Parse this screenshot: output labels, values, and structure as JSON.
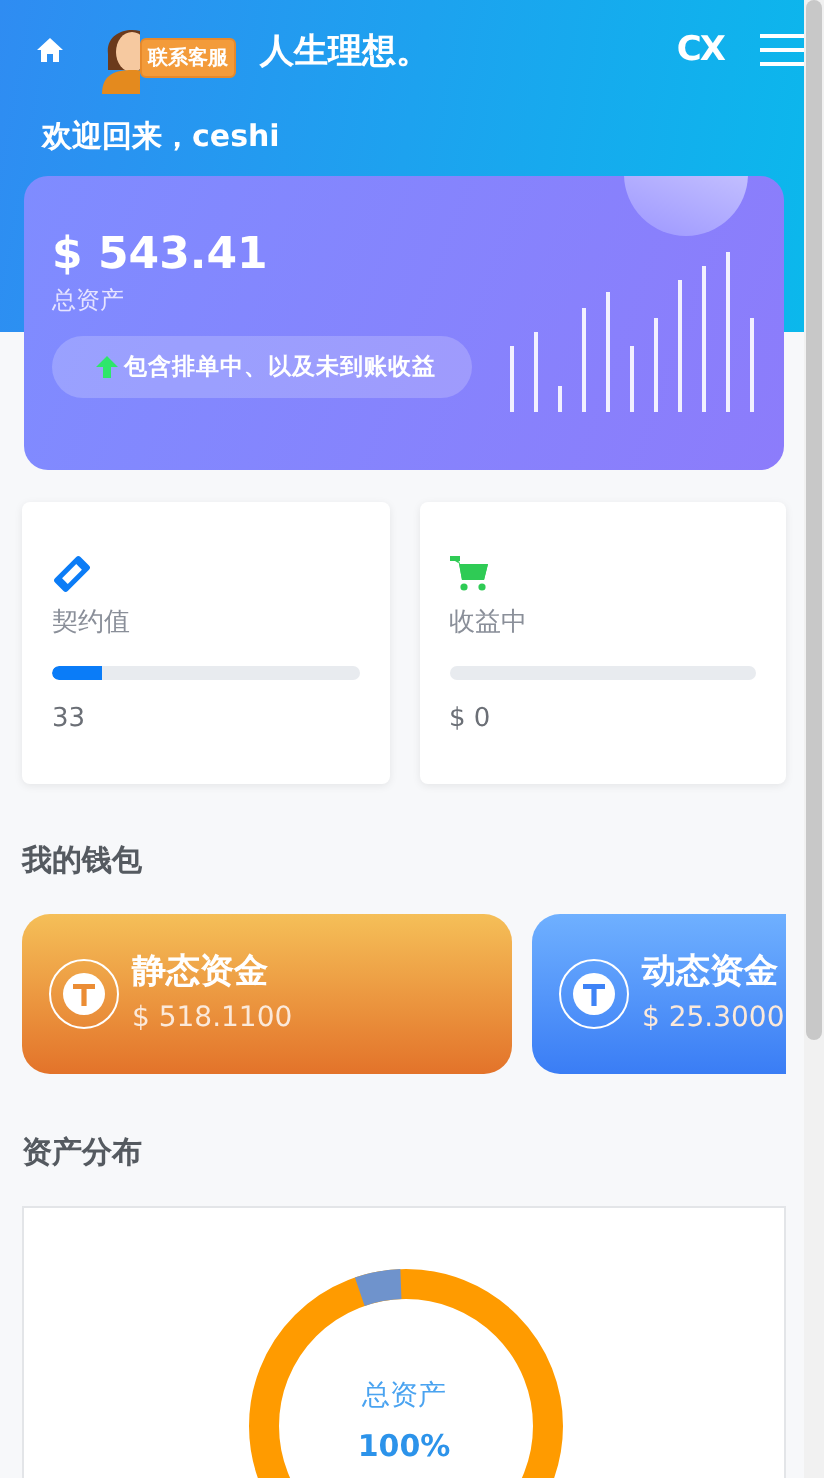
{
  "header": {
    "support_badge": "联系客服",
    "marquee": "人生理想。",
    "brand": "CX",
    "welcome": "欢迎回来，ceshi"
  },
  "balance": {
    "amount": "$ 543.41",
    "label": "总资产",
    "note": "包含排单中、以及未到账收益"
  },
  "stats": [
    {
      "kind": "contract",
      "label": "契约值",
      "level": 0.16,
      "value": "33"
    },
    {
      "kind": "earning",
      "label": "收益中",
      "level": 0,
      "value": "$ 0"
    }
  ],
  "wallet": {
    "title": "我的钱包",
    "items": [
      {
        "kind": "static",
        "name": "静态资金",
        "amount": "$ 518.1100"
      },
      {
        "kind": "dynamic",
        "name": "动态资金",
        "amount": "$ 25.3000"
      }
    ]
  },
  "distribution": {
    "title": "资产分布",
    "center_label": "总资产",
    "center_value": "100%"
  }
}
